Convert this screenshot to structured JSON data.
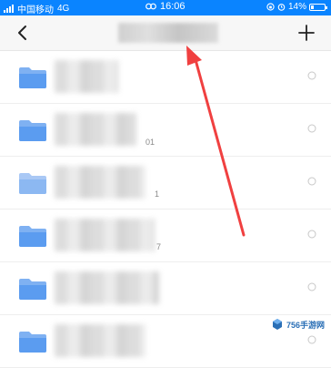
{
  "status_bar": {
    "carrier": "中国移动",
    "network": "4G",
    "time": "16:06",
    "battery": "14%",
    "battery_level": 0.14,
    "background_color": "#0a84ff"
  },
  "nav_bar": {
    "back_icon": "chevron-left-icon",
    "add_icon": "plus-icon"
  },
  "folders": [
    {
      "meta": ""
    },
    {
      "meta": "01"
    },
    {
      "meta": "1"
    },
    {
      "meta": "7"
    },
    {
      "meta": ""
    },
    {
      "meta": ""
    }
  ],
  "annotation": {
    "color": "#f04040"
  },
  "watermark": {
    "text": "756手游网"
  }
}
